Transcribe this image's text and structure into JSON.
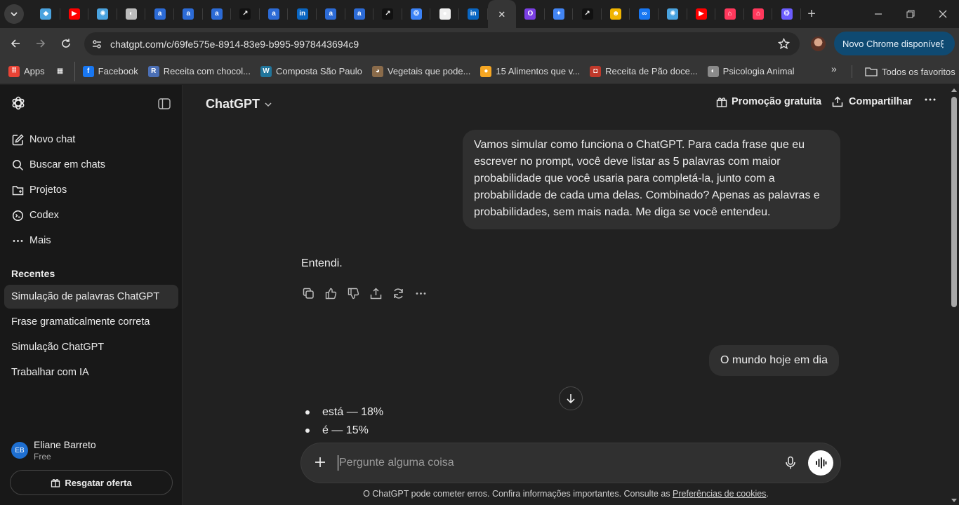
{
  "browser": {
    "tabs": [
      {
        "icon": "bird-icon",
        "color": "#4aa3df",
        "glyph": "◆"
      },
      {
        "icon": "youtube-icon",
        "color": "#ff0000",
        "glyph": "▶"
      },
      {
        "icon": "react-icon",
        "color": "#4aa3df",
        "glyph": "✺"
      },
      {
        "icon": "globe-icon",
        "color": "#bdbdbd",
        "glyph": "◐"
      },
      {
        "icon": "a-letter-icon",
        "color": "#2c6bd6",
        "glyph": "a"
      },
      {
        "icon": "a-letter-icon",
        "color": "#2c6bd6",
        "glyph": "a"
      },
      {
        "icon": "a-letter-icon",
        "color": "#2c6bd6",
        "glyph": "a"
      },
      {
        "icon": "external-link-icon",
        "color": "#111111",
        "glyph": "↗"
      },
      {
        "icon": "a-letter-icon",
        "color": "#2c6bd6",
        "glyph": "a"
      },
      {
        "icon": "linkedin-icon",
        "color": "#0a66c2",
        "glyph": "in"
      },
      {
        "icon": "a-letter-icon",
        "color": "#2c6bd6",
        "glyph": "a"
      },
      {
        "icon": "a-letter-icon",
        "color": "#2c6bd6",
        "glyph": "a"
      },
      {
        "icon": "external-link-icon",
        "color": "#111111",
        "glyph": "↗"
      },
      {
        "icon": "openai-icon",
        "color": "#3b82f6",
        "glyph": "❂"
      },
      {
        "icon": "github-icon",
        "color": "#f0f0f0",
        "glyph": "●"
      },
      {
        "icon": "linkedin-icon",
        "color": "#0a66c2",
        "glyph": "in"
      },
      {
        "icon": "close-icon",
        "color": "#353535",
        "glyph": "✕",
        "active": true
      },
      {
        "icon": "o-circle-icon",
        "color": "#7b3fe4",
        "glyph": "O"
      },
      {
        "icon": "gemini-icon",
        "color": "#4285f4",
        "glyph": "✦"
      },
      {
        "icon": "external-link-icon",
        "color": "#111111",
        "glyph": "↗"
      },
      {
        "icon": "character-icon",
        "color": "#f0b400",
        "glyph": "☻"
      },
      {
        "icon": "meta-icon",
        "color": "#1877f2",
        "glyph": "∞"
      },
      {
        "icon": "react-icon",
        "color": "#4aa3df",
        "glyph": "✺"
      },
      {
        "icon": "youtube-icon",
        "color": "#ff0000",
        "glyph": "▶"
      },
      {
        "icon": "airbnb-icon",
        "color": "#ff385c",
        "glyph": "⌂"
      },
      {
        "icon": "airbnb-icon",
        "color": "#ff385c",
        "glyph": "⌂"
      },
      {
        "icon": "openai-icon",
        "color": "#6b5cff",
        "glyph": "❂"
      }
    ],
    "url": "chatgpt.com/c/69fe575e-8914-83e9-b995-9978443694c9",
    "update_label": "Novo Chrome disponível",
    "bookmarks": [
      {
        "label": "Apps",
        "icon": "apps-grid-icon",
        "color": "#e94335",
        "glyph": "⠿"
      },
      {
        "label": "",
        "icon": "tab-groups-icon",
        "color": "#353535",
        "glyph": "▦"
      },
      {
        "label": "Facebook",
        "icon": "facebook-icon",
        "color": "#1877f2",
        "glyph": "f"
      },
      {
        "label": "Receita com chocol...",
        "icon": "recipe-icon",
        "color": "#4b6fb5",
        "glyph": "R"
      },
      {
        "label": "Composta São Paulo",
        "icon": "wordpress-icon",
        "color": "#21759b",
        "glyph": "W"
      },
      {
        "label": "Vegetais que pode...",
        "icon": "dog-icon",
        "color": "#8a6b4a",
        "glyph": "◕"
      },
      {
        "label": "15 Alimentos que v...",
        "icon": "food-icon",
        "color": "#f5a623",
        "glyph": "●"
      },
      {
        "label": "Receita de Pão doce...",
        "icon": "bread-icon",
        "color": "#c0392b",
        "glyph": "◘"
      },
      {
        "label": "Psicologia Animal",
        "icon": "globe-icon",
        "color": "#8a8a8a",
        "glyph": "◐"
      }
    ],
    "all_bookmarks_label": "Todos os favoritos"
  },
  "sidebar": {
    "nav": [
      {
        "label": "Novo chat",
        "icon": "compose-icon"
      },
      {
        "label": "Buscar em chats",
        "icon": "search-icon"
      },
      {
        "label": "Projetos",
        "icon": "folder-icon"
      },
      {
        "label": "Codex",
        "icon": "codex-icon"
      },
      {
        "label": "Mais",
        "icon": "more-dots-icon"
      }
    ],
    "recent_title": "Recentes",
    "recents": [
      {
        "label": "Simulação de palavras ChatGPT",
        "active": true
      },
      {
        "label": "Frase gramaticalmente correta",
        "active": false
      },
      {
        "label": "Simulação ChatGPT",
        "active": false
      },
      {
        "label": "Trabalhar com IA",
        "active": false
      }
    ],
    "user": {
      "initials": "EB",
      "name": "Eliane Barreto",
      "plan": "Free"
    },
    "offer_label": "Resgatar oferta"
  },
  "header": {
    "model": "ChatGPT",
    "promo_label": "Promoção gratuita",
    "share_label": "Compartilhar"
  },
  "conversation": {
    "user_message_1": "Vamos simular como funciona o ChatGPT. Para cada frase que eu escrever no prompt, você deve listar as 5 palavras com maior probabilidade que você usaria para completá-la, junto com a probabilidade de cada uma delas. Combinado? Apenas as palavras e probabilidades, sem mais nada. Me diga se você entendeu.",
    "assistant_message_1": "Entendi.",
    "user_message_2": "O mundo hoje em dia",
    "assistant_bullets": [
      "está — 18%",
      "é — 15%"
    ]
  },
  "composer": {
    "placeholder": "Pergunte alguma coisa"
  },
  "footer": {
    "disclaimer_prefix": "O ChatGPT pode cometer erros. Confira informações importantes. Consulte as ",
    "disclaimer_link": "Preferências de cookies",
    "disclaimer_suffix": "."
  },
  "colors": {
    "background": "#212121",
    "sidebar": "#181818",
    "bubble": "#303030",
    "accent_chip": "#0f4a72"
  }
}
